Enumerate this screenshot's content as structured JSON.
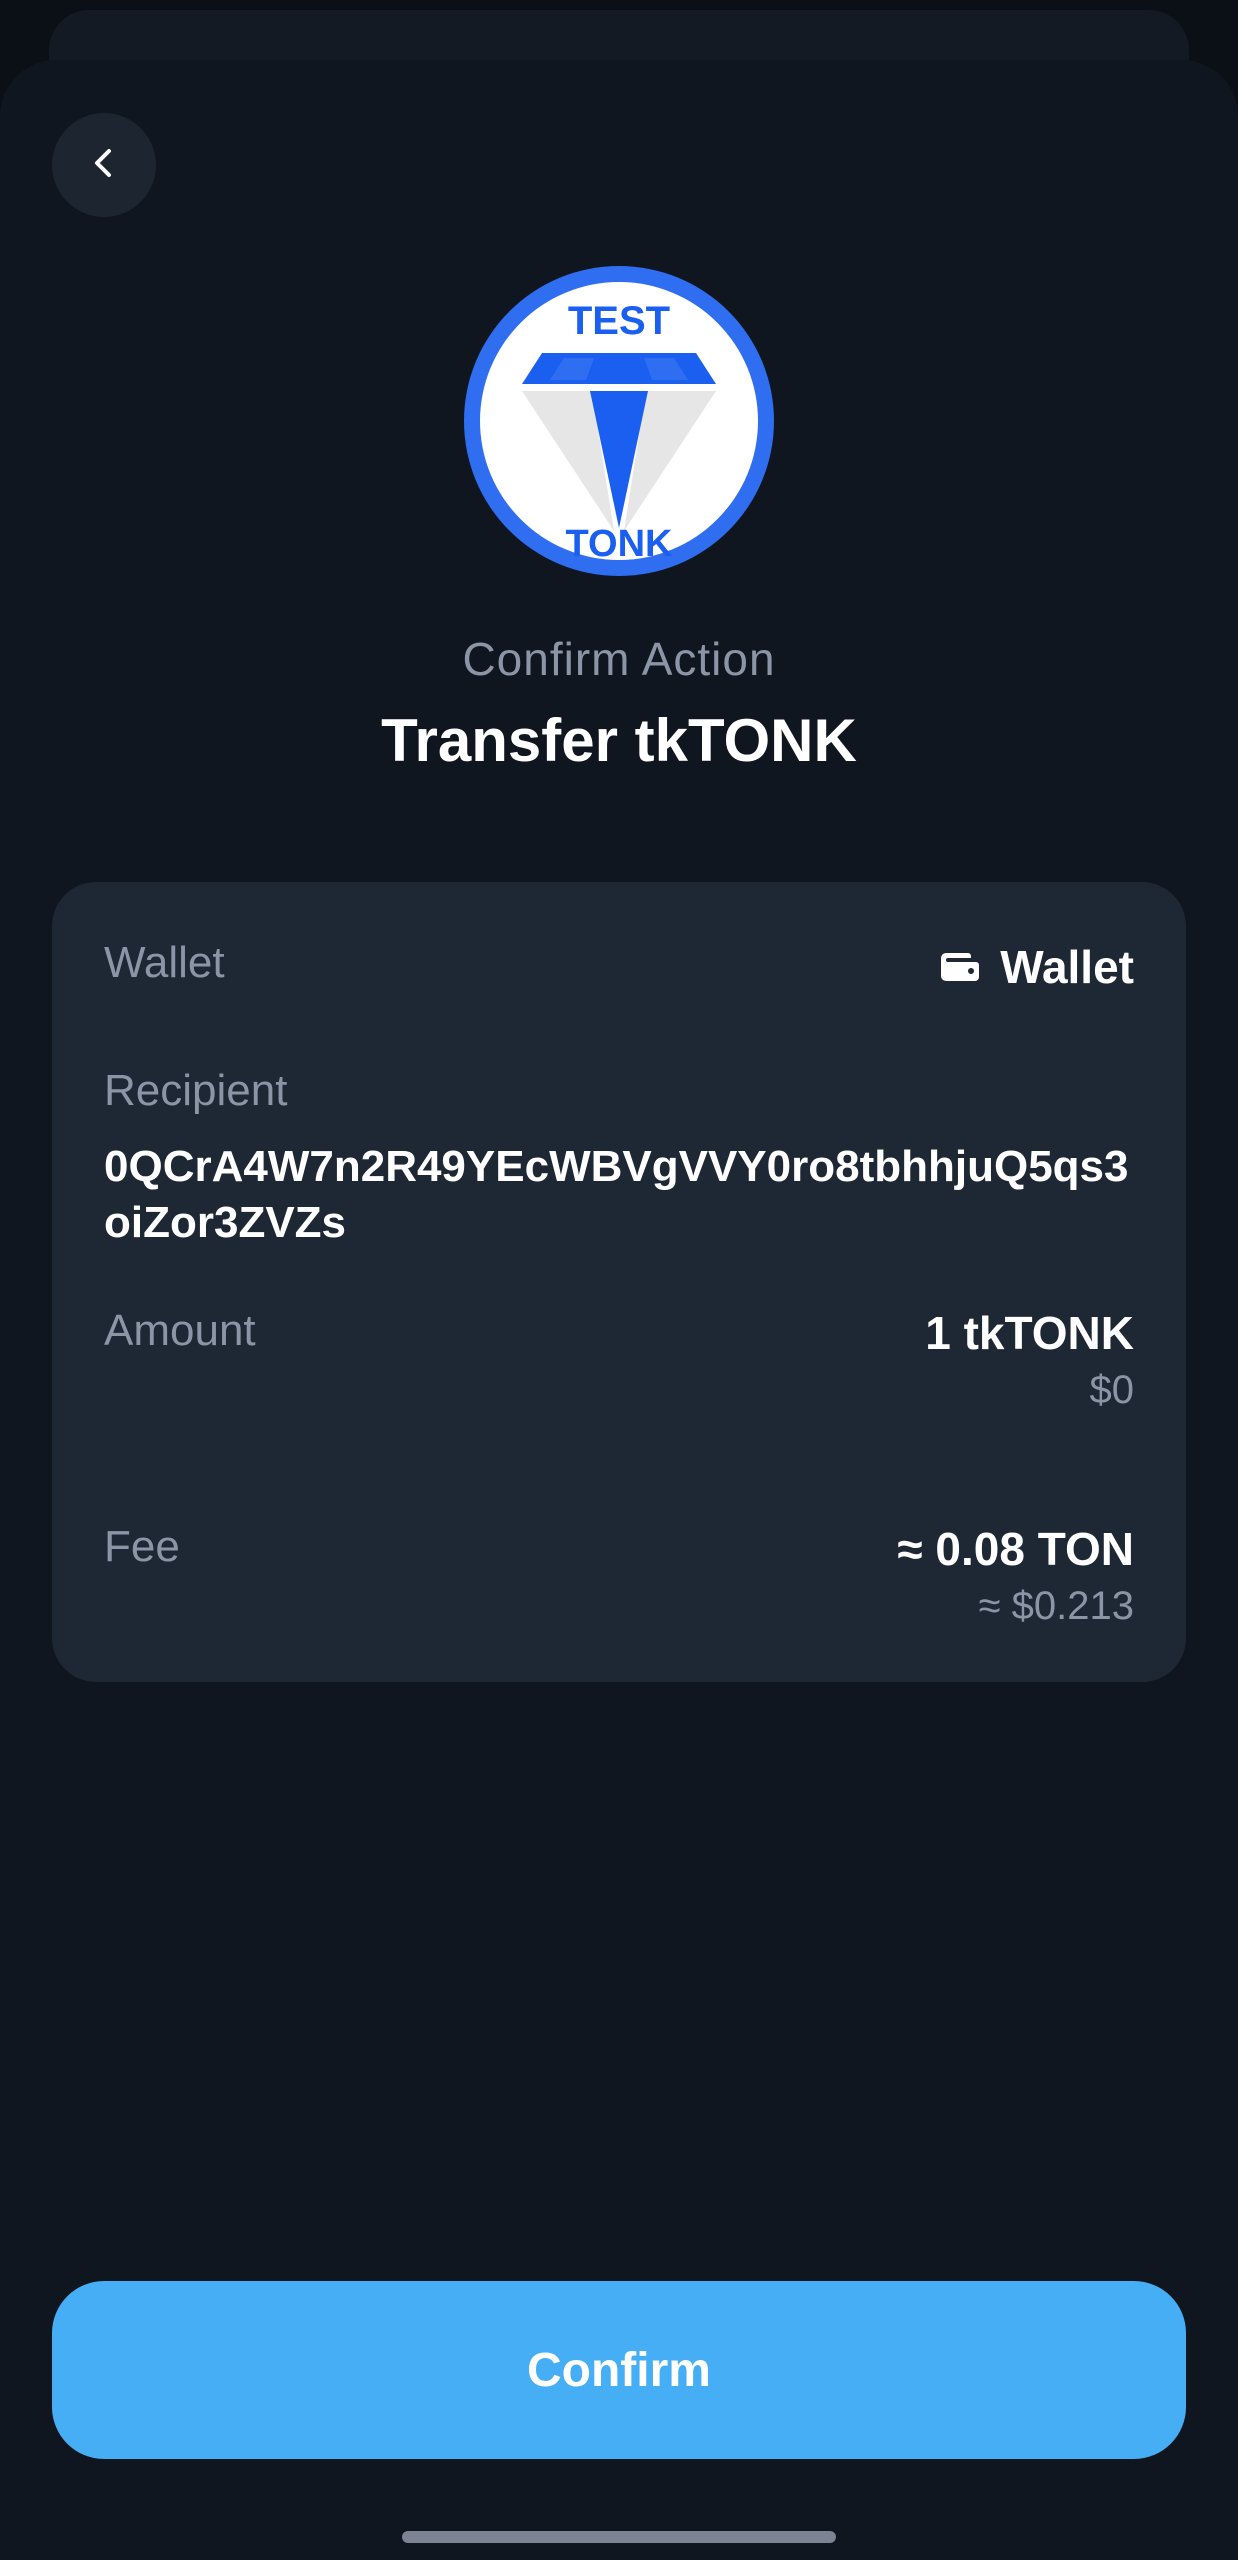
{
  "header": {
    "back_icon": "chevron-left-icon"
  },
  "token": {
    "logo_top_text": "TEST",
    "logo_bottom_text": "TONK",
    "logo_colors": {
      "ring": "#2f6ef0",
      "accent": "#1a5ff0",
      "facet": "#e6e6e6"
    }
  },
  "heading": {
    "subtitle": "Confirm Action",
    "title": "Transfer tkTONK"
  },
  "details": {
    "wallet_label": "Wallet",
    "wallet_icon": "wallet-icon",
    "wallet_value": "Wallet",
    "recipient_label": "Recipient",
    "recipient_address": "0QCrA4W7n2R49YEcWBVgVVY0ro8tbhhjuQ5qs3oiZor3ZVZs",
    "amount_label": "Amount",
    "amount_value": "1 tkTONK",
    "amount_fiat": "$0",
    "fee_label": "Fee",
    "fee_value": "≈ 0.08 TON",
    "fee_fiat": "≈ $0.213"
  },
  "actions": {
    "confirm_label": "Confirm"
  },
  "colors": {
    "background": "#10161f",
    "card": "#1e2734",
    "primary_button": "#45aef5",
    "muted_text": "#8b95a5"
  }
}
